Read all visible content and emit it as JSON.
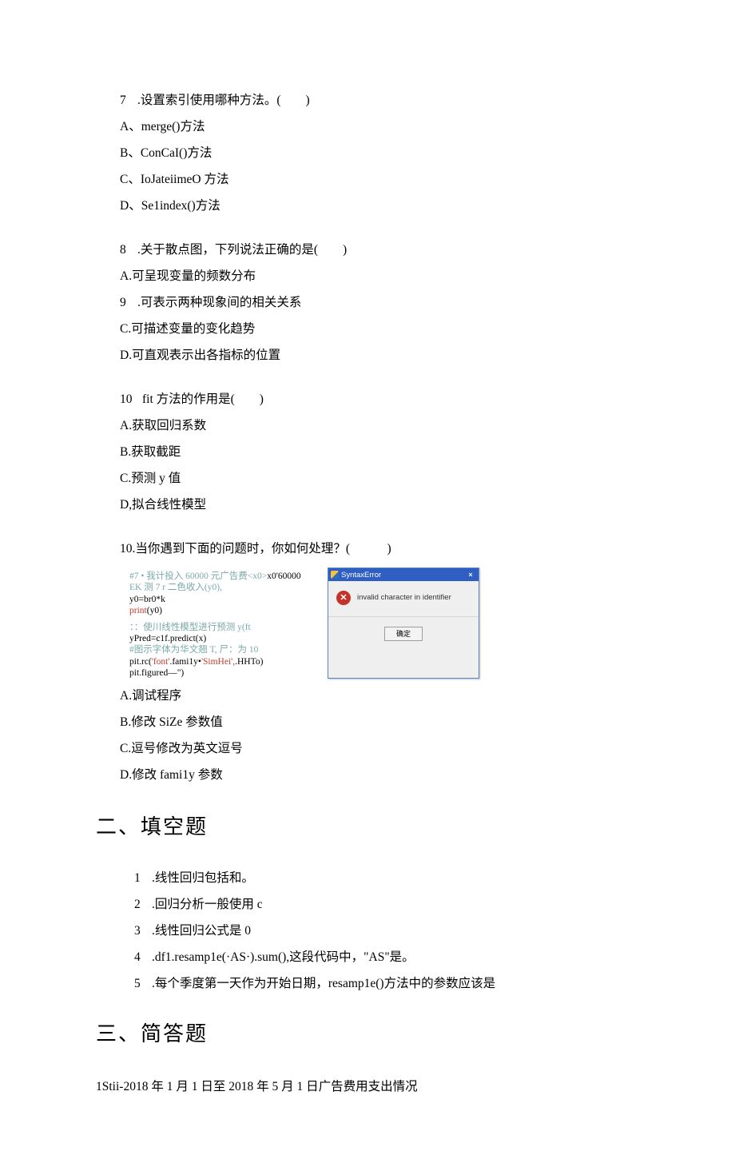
{
  "q7": {
    "stem_num": "7",
    "stem_dot": ".设置索引使用哪种方法。(  )",
    "a": "A、merge()方法",
    "b": "B、ConCaI()方法",
    "c": "C、IoJateiimeO 方法",
    "d": "D、Se1index()方法"
  },
  "q8": {
    "line1_num": "8",
    "line1": ".关于散点图，下列说法正确的是(  )",
    "a": "A.可呈现变量的频数分布",
    "line2_num": "9",
    "line2": ".可表示两种现象间的相关关系",
    "c": "C.可描述变量的变化趋势",
    "d": "D.可直观表示出各指标的位置"
  },
  "q10": {
    "stem_num": "10",
    "stem": "fit 方法的作用是(  )",
    "a": "A.获取回归系数",
    "b": "B.获取截距",
    "c": "C.预测 y 值",
    "d": "D,拟合线性模型"
  },
  "q10b": {
    "stem": "10.当你遇到下面的问题时，你如何处理？(   )",
    "code": {
      "l1a": "#7 • 我计投入 60000 元广告费<x0>",
      "l1b": "x0'60000",
      "l2": " EK 测 7 r 二色收入(y0),",
      "l3": "y0=br0*k",
      "l4a": "print",
      "l4b": "(y0)",
      "l5": " ：：使川线性模型进行预测 y(ft",
      "l6": "yPred=c1f.predict(x)",
      "l7": "#图示字体为华文翘 T,  尸：为 10",
      "l8a": "pit.rc(",
      "l8b": "'font'",
      "l8c": ".fami1y•",
      "l8d": "'SimHei',",
      "l8e": ".HHTo)",
      "l9": "pit.figured—\")"
    },
    "dialog": {
      "title": "SyntaxError",
      "close": "×",
      "msg": "invalid character in identifier",
      "btn": "确定"
    },
    "a": "A.调试程序",
    "b": "B.修改 SiZe 参数值",
    "c": "C.逗号修改为英文逗号",
    "d": "D.修改 fami1y 参数"
  },
  "sections": {
    "fill": "二、填空题",
    "short": "三、简答题"
  },
  "fill": {
    "n1": "1",
    "t1": ".线性回归包括和。",
    "n2": "2",
    "t2": ".回归分析一般使用 c",
    "n3": "3",
    "t3": ".线性回归公式是 0",
    "n4": "4",
    "t4": ".df1.resamp1e(·AS·).sum(),这段代码中，\"AS\"是。",
    "n5": "5",
    "t5": ".每个季度第一天作为开始日期，resamp1e()方法中的参数应该是"
  },
  "bottom": "1Stii-2018 年 1 月 1 日至 2018 年 5 月 1 日广告费用支出情况"
}
